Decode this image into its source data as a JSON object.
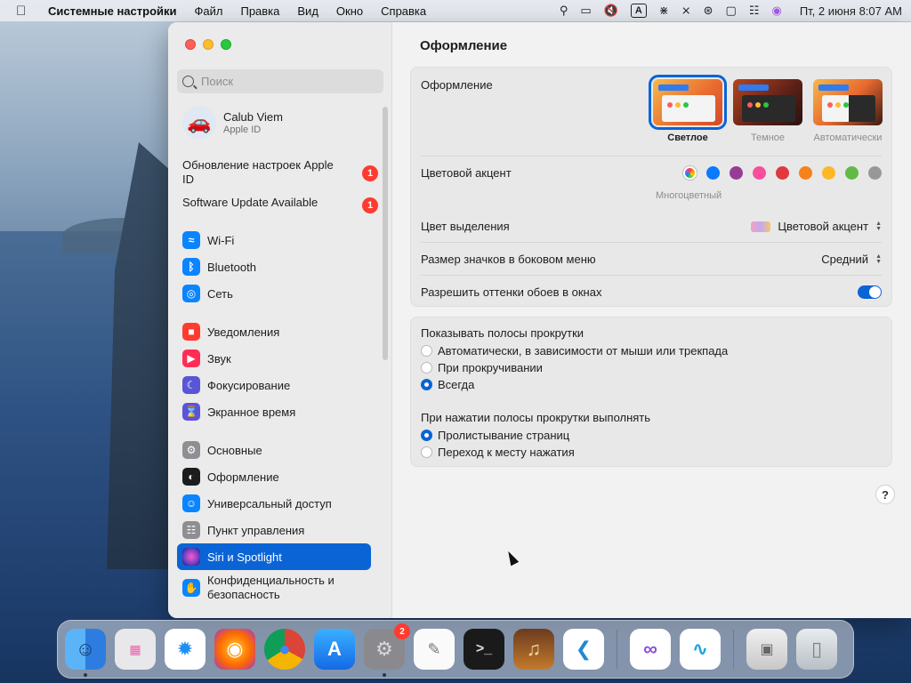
{
  "menubar": {
    "app_name": "Системные настройки",
    "menus": [
      "Файл",
      "Правка",
      "Вид",
      "Окно",
      "Справка"
    ],
    "input_indicator": "A",
    "clock": "Пт, 2 июня  8:07 AM"
  },
  "sidebar": {
    "search_placeholder": "Поиск",
    "user": {
      "name": "Calub Viem",
      "subtitle": "Apple ID"
    },
    "notices": [
      {
        "label": "Обновление настроек Apple ID",
        "badge": "1"
      },
      {
        "label": "Software Update Available",
        "badge": "1"
      }
    ],
    "group1": [
      {
        "label": "Wi-Fi",
        "icon": "wifi-icon",
        "color": "#0a84ff"
      },
      {
        "label": "Bluetooth",
        "icon": "bluetooth-icon",
        "color": "#0a84ff"
      },
      {
        "label": "Сеть",
        "icon": "globe-icon",
        "color": "#0a84ff"
      }
    ],
    "group2": [
      {
        "label": "Уведомления",
        "icon": "bell-icon",
        "color": "#ff3b30"
      },
      {
        "label": "Звук",
        "icon": "speaker-icon",
        "color": "#ff2d55"
      },
      {
        "label": "Фокусирование",
        "icon": "moon-icon",
        "color": "#5856d6"
      },
      {
        "label": "Экранное время",
        "icon": "hourglass-icon",
        "color": "#5856d6"
      }
    ],
    "group3": [
      {
        "label": "Основные",
        "icon": "gear-icon",
        "color": "#8e8e93"
      },
      {
        "label": "Оформление",
        "icon": "appearance-icon",
        "color": "#1c1c1e"
      },
      {
        "label": "Универсальный доступ",
        "icon": "accessibility-icon",
        "color": "#0a84ff"
      },
      {
        "label": "Пункт управления",
        "icon": "control-center-icon",
        "color": "#8e8e93"
      },
      {
        "label": "Siri и Spotlight",
        "icon": "siri-icon",
        "color": "#6a3fc7"
      },
      {
        "label": "Конфиденциальность и безопасность",
        "icon": "hand-icon",
        "color": "#0a84ff"
      }
    ]
  },
  "content": {
    "title": "Оформление",
    "appearance": {
      "label": "Оформление",
      "options": [
        {
          "label": "Светлое",
          "selected": true
        },
        {
          "label": "Темное",
          "selected": false
        },
        {
          "label": "Автоматически",
          "selected": false
        }
      ]
    },
    "accent": {
      "label": "Цветовой акцент",
      "selected_caption": "Многоцветный",
      "colors": [
        "#0a7aff",
        "#953d96",
        "#f74f9e",
        "#e0383e",
        "#f7821b",
        "#fcb827",
        "#62ba46",
        "#989898"
      ]
    },
    "highlight": {
      "label": "Цвет выделения",
      "value": "Цветовой акцент"
    },
    "sidebar_icon_size": {
      "label": "Размер значков в боковом меню",
      "value": "Средний"
    },
    "wallpaper_tint": {
      "label": "Разрешить оттенки обоев в окнах",
      "enabled": true
    },
    "scrollbars": {
      "label": "Показывать полосы прокрутки",
      "options": [
        {
          "label": "Автоматически, в зависимости от мыши или трекпада",
          "selected": false
        },
        {
          "label": "При прокручивании",
          "selected": false
        },
        {
          "label": "Всегда",
          "selected": true
        }
      ]
    },
    "click_scroll": {
      "label": "При нажатии полосы прокрутки выполнять",
      "options": [
        {
          "label": "Пролистывание страниц",
          "selected": true
        },
        {
          "label": "Переход к месту нажатия",
          "selected": false
        }
      ]
    },
    "help": "?"
  },
  "dock": {
    "system_settings_badge": "2"
  }
}
